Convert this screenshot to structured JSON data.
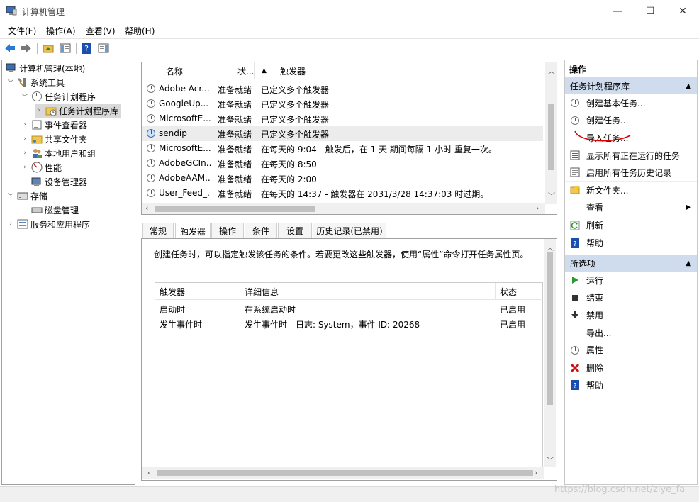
{
  "window": {
    "title": "计算机管理",
    "minimize": "—",
    "maximize": "☐",
    "close": "✕"
  },
  "menu": [
    "文件(F)",
    "操作(A)",
    "查看(V)",
    "帮助(H)"
  ],
  "tree": {
    "root": "计算机管理(本地)",
    "system_tools": "系统工具",
    "task_scheduler": "任务计划程序",
    "task_library": "任务计划程序库",
    "event_viewer": "事件查看器",
    "shared_folders": "共享文件夹",
    "local_users": "本地用户和组",
    "performance": "性能",
    "device_manager": "设备管理器",
    "storage": "存储",
    "disk_management": "磁盘管理",
    "services": "服务和应用程序"
  },
  "task_list": {
    "headers": {
      "name": "名称",
      "status": "状...",
      "triggers": "触发器"
    },
    "rows": [
      {
        "name": "Adobe Acr...",
        "status": "准备就绪",
        "trigger": "已定义多个触发器"
      },
      {
        "name": "GoogleUp...",
        "status": "准备就绪",
        "trigger": "已定义多个触发器"
      },
      {
        "name": "MicrosoftE...",
        "status": "准备就绪",
        "trigger": "已定义多个触发器"
      },
      {
        "name": "sendip",
        "status": "准备就绪",
        "trigger": "已定义多个触发器"
      },
      {
        "name": "MicrosoftE...",
        "status": "准备就绪",
        "trigger": "在每天的 9:04 - 触发后，在 1 天 期间每隔 1 小时 重复一次。"
      },
      {
        "name": "AdobeGCIn...",
        "status": "准备就绪",
        "trigger": "在每天的 8:50"
      },
      {
        "name": "AdobeAAM...",
        "status": "准备就绪",
        "trigger": "在每天的 2:00"
      },
      {
        "name": "User_Feed_...",
        "status": "准备就绪",
        "trigger": "在每天的 14:37 - 触发器在 2031/3/28 14:37:03 时过期。"
      }
    ]
  },
  "detail_tabs": [
    "常规",
    "触发器",
    "操作",
    "条件",
    "设置",
    "历史记录(已禁用)"
  ],
  "trigger_pane": {
    "description": "创建任务时，可以指定触发该任务的条件。若要更改这些触发器，使用“属性”命令打开任务属性页。",
    "headers": {
      "trigger": "触发器",
      "details": "详细信息",
      "status": "状态"
    },
    "rows": [
      {
        "trigger": "启动时",
        "details": "在系统启动时",
        "status": "已启用"
      },
      {
        "trigger": "发生事件时",
        "details": "发生事件时 - 日志: System，事件 ID: 20268",
        "status": "已启用"
      }
    ]
  },
  "actions": {
    "title": "操作",
    "section1": "任务计划程序库",
    "items1": [
      {
        "label": "创建基本任务...",
        "icon": "clock-icon"
      },
      {
        "label": "创建任务...",
        "icon": "clock-icon"
      },
      {
        "label": "导入任务...",
        "icon": "none"
      },
      {
        "label": "显示所有正在运行的任务",
        "icon": "list-icon"
      },
      {
        "label": "启用所有任务历史记录",
        "icon": "history-icon"
      },
      {
        "label": "新文件夹...",
        "icon": "folder-icon"
      },
      {
        "label": "查看",
        "icon": "none"
      },
      {
        "label": "刷新",
        "icon": "refresh-icon"
      },
      {
        "label": "帮助",
        "icon": "help-icon"
      }
    ],
    "section2": "所选项",
    "items2": [
      {
        "label": "运行",
        "icon": "run-icon"
      },
      {
        "label": "结束",
        "icon": "stop-icon"
      },
      {
        "label": "禁用",
        "icon": "disable-icon"
      },
      {
        "label": "导出...",
        "icon": "none"
      },
      {
        "label": "属性",
        "icon": "properties-icon"
      },
      {
        "label": "删除",
        "icon": "delete-icon"
      },
      {
        "label": "帮助",
        "icon": "help-icon"
      }
    ]
  },
  "watermark": "https://blog.csdn.net/zlye_fa",
  "colors": {
    "section_header": "#cfdcee",
    "selection": "#d9d9d9",
    "annotation": "#e00000",
    "run_green": "#2a9a2a",
    "delete_red": "#d01010",
    "help_blue": "#1a4fb0"
  }
}
